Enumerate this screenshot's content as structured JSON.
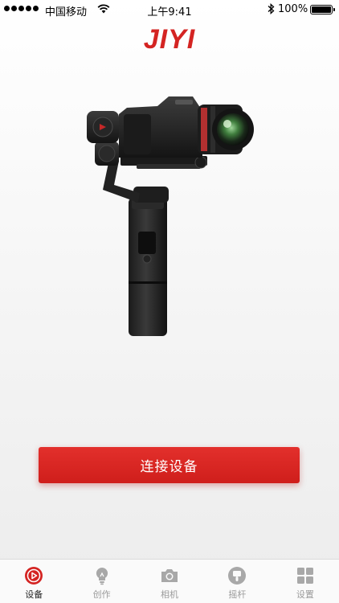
{
  "status_bar": {
    "carrier": "中国移动",
    "time": "上午9:41",
    "battery": "100%"
  },
  "app": {
    "brand": "JIYI"
  },
  "main": {
    "connect_label": "连接设备"
  },
  "tabs": [
    {
      "label": "设备",
      "icon": "play-circle-icon",
      "active": true
    },
    {
      "label": "创作",
      "icon": "lightbulb-icon",
      "active": false
    },
    {
      "label": "相机",
      "icon": "camera-icon",
      "active": false
    },
    {
      "label": "摇杆",
      "icon": "joystick-icon",
      "active": false
    },
    {
      "label": "设置",
      "icon": "grid-icon",
      "active": false
    }
  ],
  "colors": {
    "accent": "#d42422",
    "tab_inactive": "#9a9a9a"
  }
}
